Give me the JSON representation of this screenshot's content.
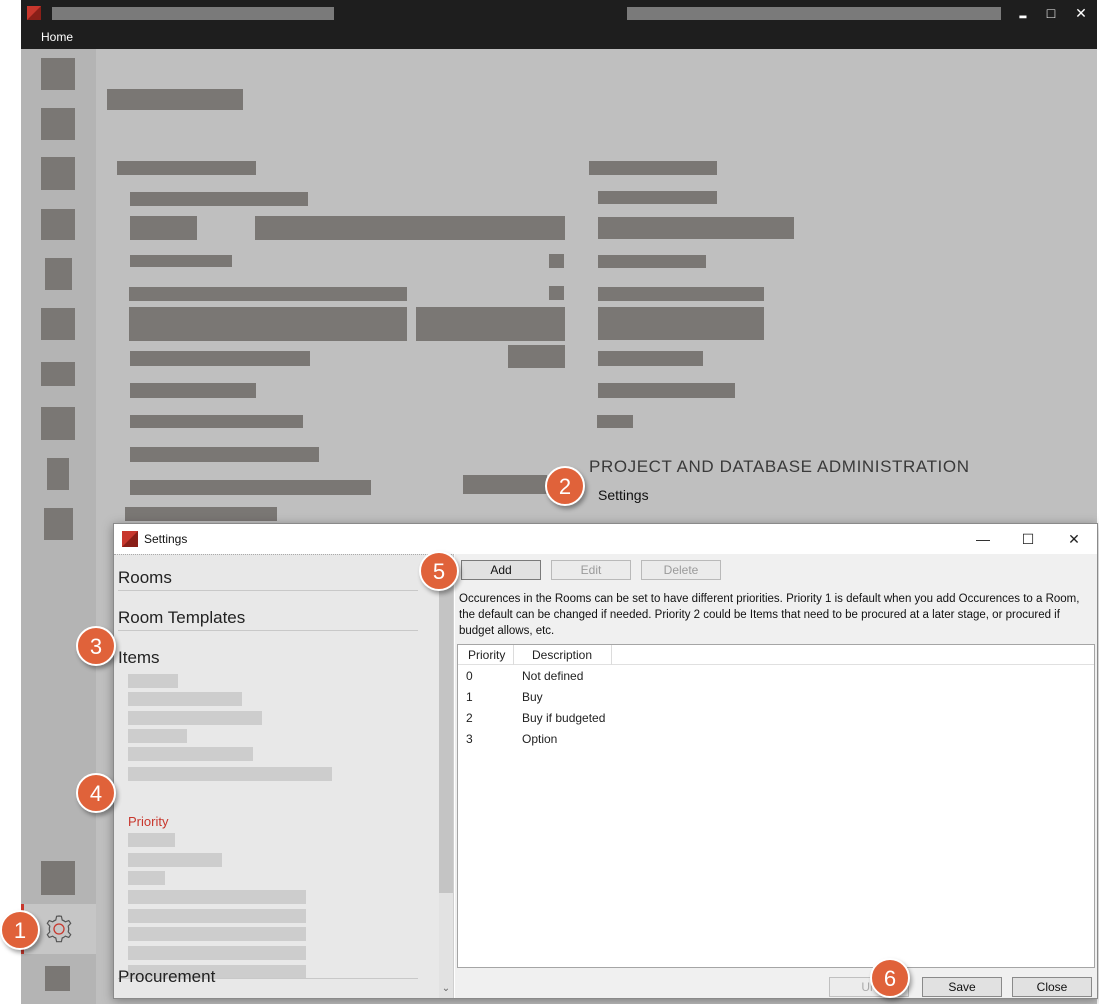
{
  "menu": {
    "home_label": "Home"
  },
  "window_controls": {
    "minimize": "▂",
    "maximize": "□",
    "close": "✕"
  },
  "main": {
    "admin_heading": "PROJECT AND DATABASE ADMINISTRATION",
    "settings_link": "Settings"
  },
  "callouts": [
    "1",
    "2",
    "3",
    "4",
    "5",
    "6"
  ],
  "dialog": {
    "title": "Settings",
    "controls": {
      "minimize": "—",
      "maximize": "☐",
      "close": "✕"
    },
    "sections": [
      "Rooms",
      "Room Templates",
      "Items",
      "Procurement"
    ],
    "selected_item": "Priority",
    "toolbar": {
      "add": "Add",
      "edit": "Edit",
      "delete": "Delete"
    },
    "description": "Occurences in the Rooms can be set to have different priorities. Priority 1 is default when you add Occurences to a Room, the default can be changed if needed. Priority 2 could be Items that need to be procured at a later stage, or procured if budget allows, etc.",
    "grid": {
      "columns": [
        "Priority",
        "Description"
      ],
      "rows": [
        {
          "priority": "0",
          "description": "Not defined"
        },
        {
          "priority": "1",
          "description": "Buy"
        },
        {
          "priority": "2",
          "description": "Buy if budgeted"
        },
        {
          "priority": "3",
          "description": "Option"
        }
      ]
    },
    "footer": {
      "undo": "Un",
      "save": "Save",
      "close": "Close"
    }
  },
  "colors": {
    "accent": "#c8372d",
    "callout": "#e0623a",
    "titlebar": "#1e1e1e"
  },
  "icons": {
    "sidebar_active": "gear-icon"
  }
}
